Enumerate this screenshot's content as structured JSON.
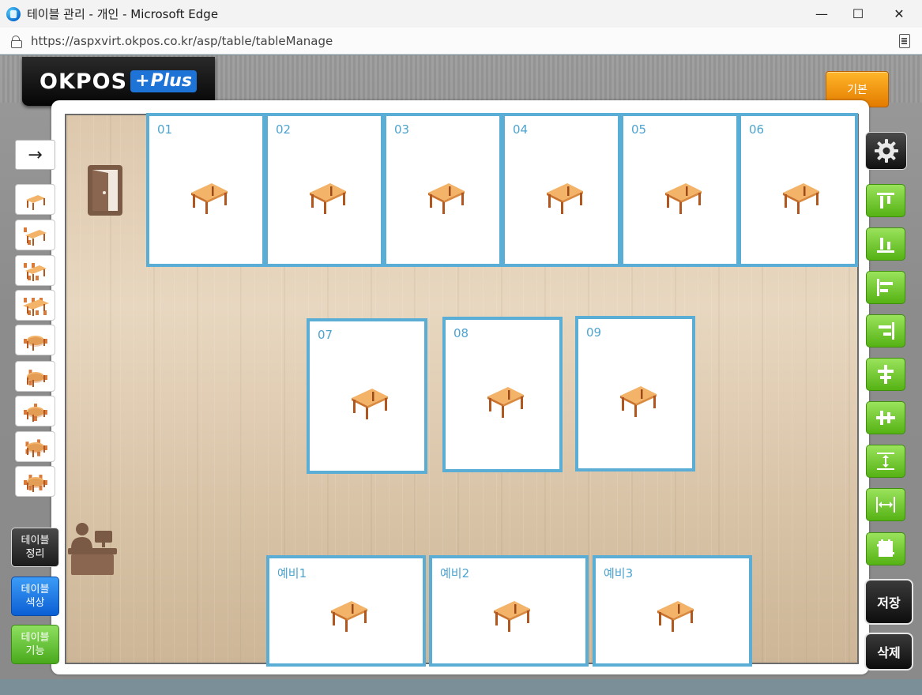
{
  "browser": {
    "title": "테이블 관리 - 개인 - Microsoft Edge",
    "url": "https://aspxvirt.okpos.co.kr/asp/table/tableManage",
    "minimize_glyph": "—",
    "maximize_glyph": "☐",
    "close_glyph": "✕"
  },
  "logo": {
    "text": "OKPOS",
    "plus_sign": "+",
    "plus_text": "Plus"
  },
  "header": {
    "default_button": "기본"
  },
  "left_toolbar": {
    "arrow_glyph": "→",
    "table_types": [
      "table-1",
      "table-2",
      "table-4",
      "table-6",
      "round-table-2",
      "round-table-3",
      "round-table-4",
      "round-table-5",
      "round-table-6"
    ]
  },
  "side_buttons": {
    "arrange": "테이블\n정리",
    "color": "테이블\n색상",
    "function": "테이블\n기능"
  },
  "right_toolbar": {
    "settings": "gear-icon",
    "align_tools": [
      "align-top-icon",
      "align-bottom-icon",
      "align-left-icon",
      "align-right-icon",
      "align-vcenter-icon",
      "align-hcenter-icon",
      "distribute-vertical-icon",
      "distribute-horizontal-icon",
      "resize-icon"
    ],
    "save": "저장",
    "delete": "삭제"
  },
  "colors": {
    "table_border": "#5aaed6",
    "table_number": "#4da4d0",
    "accent_orange": "#f39a10",
    "accent_green": "#6cc52e",
    "accent_blue": "#1e73d6"
  },
  "tables": [
    {
      "label": "01"
    },
    {
      "label": "02"
    },
    {
      "label": "03"
    },
    {
      "label": "04"
    },
    {
      "label": "05"
    },
    {
      "label": "06"
    },
    {
      "label": "07"
    },
    {
      "label": "08"
    },
    {
      "label": "09"
    },
    {
      "label": "예비1"
    },
    {
      "label": "예비2"
    },
    {
      "label": "예비3"
    }
  ]
}
